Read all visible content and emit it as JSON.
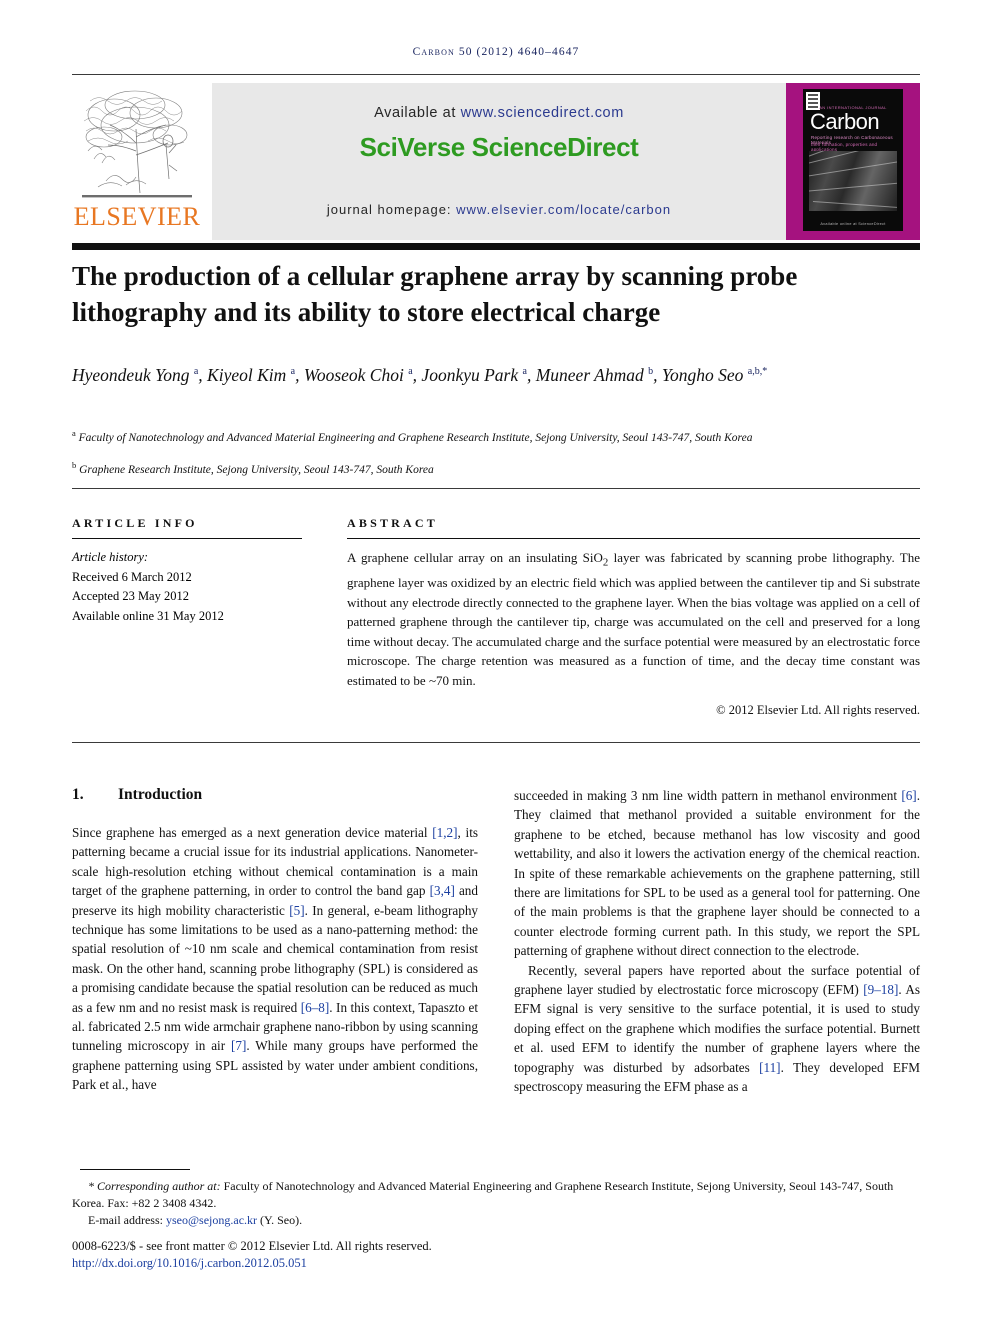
{
  "journal": {
    "running_head": "Carbon 50 (2012) 4640–4647",
    "publisher": "ELSEVIER",
    "available_at_label": "Available at ",
    "available_at_url": "www.sciencedirect.com",
    "platform_logo": "SciVerse ScienceDirect",
    "homepage_label": "journal homepage: ",
    "homepage_url": "www.elsevier.com/locate/carbon",
    "cover": {
      "supertitle": "AN INTERNATIONAL JOURNAL",
      "title": "Carbon",
      "subtitle_1": "Reporting research on Carbonaceous Materials",
      "subtitle_2": "their formation, properties and applications",
      "footer": "Available online at ScienceDirect"
    },
    "colors": {
      "link": "#2b3a8f",
      "sciverse_green": "#2e9b21",
      "elsevier_orange": "#e87722",
      "cover_magenta": "#a5127f",
      "reference_blue": "#1b3fa0",
      "running_head_navy": "#1b2660"
    }
  },
  "article": {
    "title": "The production of a cellular graphene array by scanning probe lithography and its ability to store electrical charge",
    "authors": "Hyeondeuk Yong a, Kiyeol Kim a, Wooseok Choi a, Joonkyu Park a, Muneer Ahmad b, Yongho Seo a,b,*",
    "author_list": [
      {
        "name": "Hyeondeuk Yong",
        "marks": "a"
      },
      {
        "name": "Kiyeol Kim",
        "marks": "a"
      },
      {
        "name": "Wooseok Choi",
        "marks": "a"
      },
      {
        "name": "Joonkyu Park",
        "marks": "a"
      },
      {
        "name": "Muneer Ahmad",
        "marks": "b"
      },
      {
        "name": "Yongho Seo",
        "marks": "a,b,*"
      }
    ],
    "affiliations": [
      {
        "mark": "a",
        "text": "Faculty of Nanotechnology and Advanced Material Engineering and Graphene Research Institute, Sejong University, Seoul 143-747, South Korea"
      },
      {
        "mark": "b",
        "text": "Graphene Research Institute, Sejong University, Seoul 143-747, South Korea"
      }
    ]
  },
  "article_info": {
    "heading": "ARTICLE INFO",
    "history_label": "Article history:",
    "received": "Received 6 March 2012",
    "accepted": "Accepted 23 May 2012",
    "available_online": "Available online 31 May 2012"
  },
  "abstract": {
    "heading": "ABSTRACT",
    "text": "A graphene cellular array on an insulating SiO2 layer was fabricated by scanning probe lithography. The graphene layer was oxidized by an electric field which was applied between the cantilever tip and Si substrate without any electrode directly connected to the graphene layer. When the bias voltage was applied on a cell of patterned graphene through the cantilever tip, charge was accumulated on the cell and preserved for a long time without decay. The accumulated charge and the surface potential were measured by an electrostatic force microscope. The charge retention was measured as a function of time, and the decay time constant was estimated to be ~70 min.",
    "copyright": "© 2012 Elsevier Ltd. All rights reserved."
  },
  "body": {
    "section_number": "1.",
    "section_title": "Introduction",
    "left_column_paragraph": "Since graphene has emerged as a next generation device material [1,2], its patterning became a crucial issue for its industrial applications. Nanometer-scale high-resolution etching without chemical contamination is a main target of the graphene patterning, in order to control the band gap [3,4] and preserve its high mobility characteristic [5]. In general, e-beam lithography technique has some limitations to be used as a nano-patterning method: the spatial resolution of ~10 nm scale and chemical contamination from resist mask. On the other hand, scanning probe lithography (SPL) is considered as a promising candidate because the spatial resolution can be reduced as much as a few nm and no resist mask is required [6–8]. In this context, Tapaszto et al. fabricated 2.5 nm wide armchair graphene nano-ribbon by using scanning tunneling microscopy in air [7]. While many groups have performed the graphene patterning using SPL assisted by water under ambient conditions, Park et al., have",
    "right_column_paragraph_1": "succeeded in making 3 nm line width pattern in methanol environment [6]. They claimed that methanol provided a suitable environment for the graphene to be etched, because methanol has low viscosity and good wettability, and also it lowers the activation energy of the chemical reaction. In spite of these remarkable achievements on the graphene patterning, still there are limitations for SPL to be used as a general tool for patterning. One of the main problems is that the graphene layer should be connected to a counter electrode forming current path. In this study, we report the SPL patterning of graphene without direct connection to the electrode.",
    "right_column_paragraph_2": "Recently, several papers have reported about the surface potential of graphene layer studied by electrostatic force microscopy (EFM) [9–18]. As EFM signal is very sensitive to the surface potential, it is used to study doping effect on the graphene which modifies the surface potential. Burnett et al. used EFM to identify the number of graphene layers where the topography was disturbed by adsorbates [11]. They developed EFM spectroscopy measuring the EFM phase as a"
  },
  "footer": {
    "corresponding_marker": "*",
    "corresponding_label": "Corresponding author at:",
    "corresponding_text": " Faculty of Nanotechnology and Advanced Material Engineering and Graphene Research Institute, Sejong University, Seoul 143-747, South Korea. Fax: +82 2 3408 4342.",
    "email_label": "E-mail address: ",
    "email": "yseo@sejong.ac.kr",
    "email_suffix": " (Y. Seo).",
    "issn_line": "0008-6223/$ - see front matter © 2012 Elsevier Ltd. All rights reserved.",
    "doi": "http://dx.doi.org/10.1016/j.carbon.2012.05.051"
  }
}
